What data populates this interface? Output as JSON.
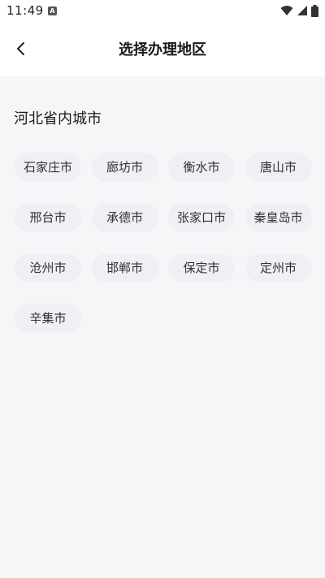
{
  "status_bar": {
    "time": "11:49",
    "notification_icon": "A",
    "icons": [
      "wifi-icon",
      "signal-icon",
      "battery-icon"
    ]
  },
  "header": {
    "title": "选择办理地区",
    "back_icon": "chevron-left-icon"
  },
  "section": {
    "title": "河北省内城市"
  },
  "cities": [
    "石家庄市",
    "廊坊市",
    "衡水市",
    "唐山市",
    "邢台市",
    "承德市",
    "张家口市",
    "秦皇岛市",
    "沧州市",
    "邯郸市",
    "保定市",
    "定州市",
    "辛集市"
  ],
  "colors": {
    "background": "#f5f6f8",
    "chip_background": "#eef0f3",
    "text": "#333333"
  }
}
